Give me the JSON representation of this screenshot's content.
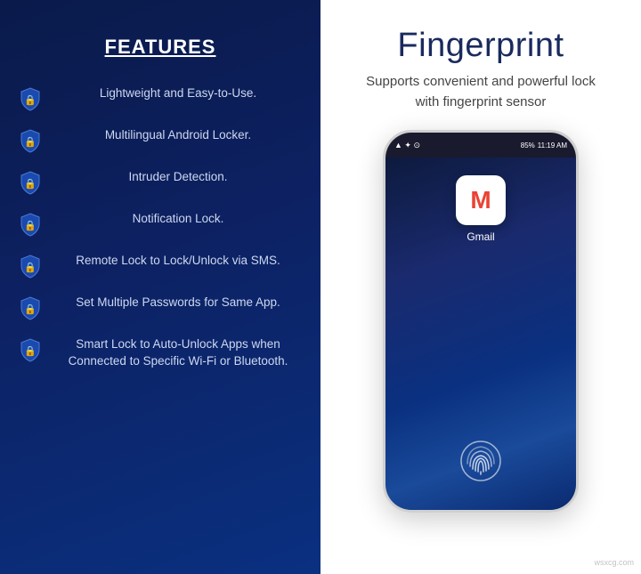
{
  "left": {
    "title": "FEATURES",
    "features": [
      {
        "id": "feature-1",
        "text": "Lightweight and Easy-to-Use."
      },
      {
        "id": "feature-2",
        "text": "Multilingual Android Locker."
      },
      {
        "id": "feature-3",
        "text": "Intruder Detection."
      },
      {
        "id": "feature-4",
        "text": "Notification Lock."
      },
      {
        "id": "feature-5",
        "text": "Remote Lock to Lock/Unlock via SMS."
      },
      {
        "id": "feature-6",
        "text": "Set Multiple Passwords for Same App."
      },
      {
        "id": "feature-7",
        "text": "Smart Lock to Auto-Unlock Apps when Connected to Specific Wi-Fi or Bluetooth."
      }
    ]
  },
  "right": {
    "title": "Fingerprint",
    "subtitle": "Supports convenient and powerful lock with fingerprint sensor",
    "phone": {
      "status_left": "▲ ✦ ⊙",
      "battery": "85%",
      "time": "11:19 AM",
      "app_label": "Gmail"
    },
    "watermark": "wsxcg.com"
  }
}
